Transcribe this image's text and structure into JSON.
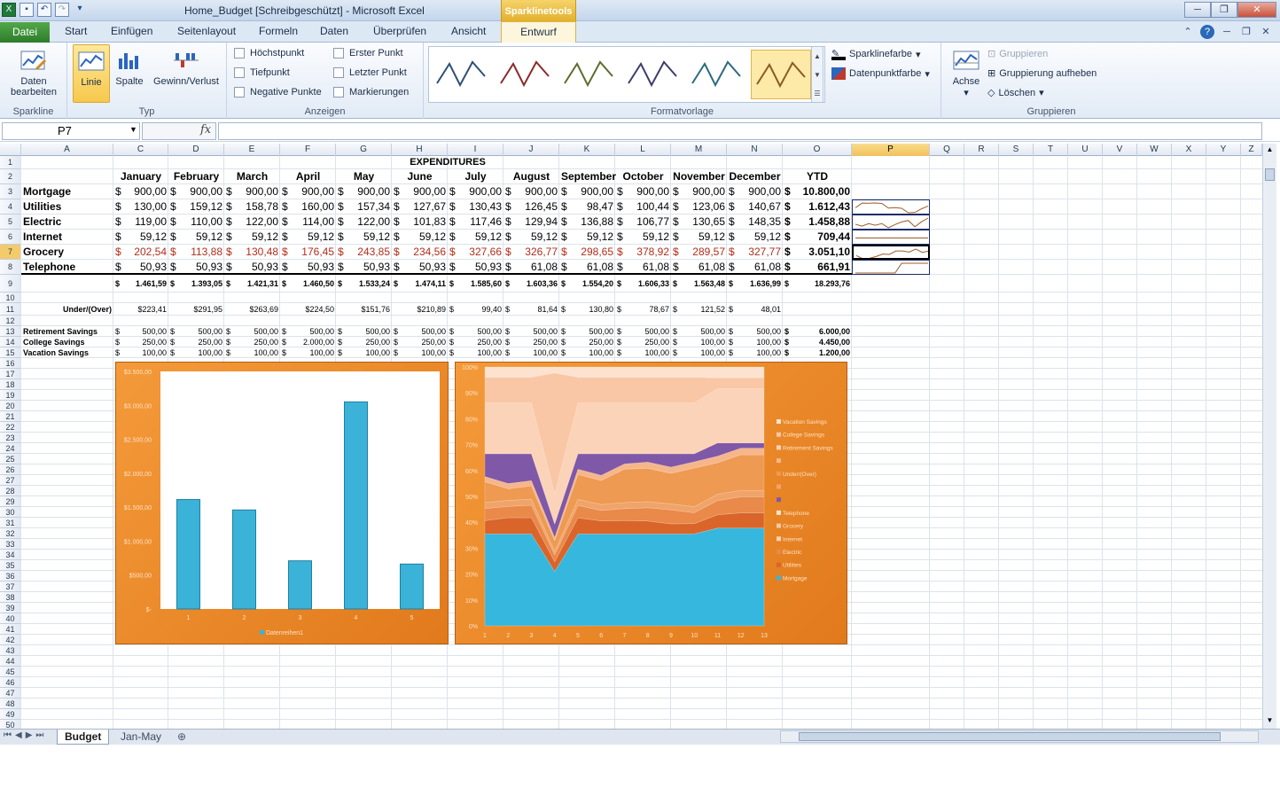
{
  "window": {
    "title": "Home_Budget  [Schreibgeschützt]  -  Microsoft Excel",
    "context_tab_group": "Sparklinetools",
    "controls": [
      "─",
      "❐",
      "✕"
    ]
  },
  "qat": {
    "icons": [
      "excel-icon",
      "save-icon",
      "undo-icon",
      "redo-icon",
      "customize-icon"
    ]
  },
  "tabs": {
    "file": "Datei",
    "items": [
      "Start",
      "Einfügen",
      "Seitenlayout",
      "Formeln",
      "Daten",
      "Überprüfen",
      "Ansicht"
    ],
    "context": "Entwurf"
  },
  "ribbon": {
    "sparkline_group": {
      "label": "Sparkline",
      "edit_data": "Daten\nbearbeiten"
    },
    "typ_group": {
      "label": "Typ",
      "line": "Linie",
      "column": "Spalte",
      "winloss": "Gewinn/Verlust"
    },
    "anzeigen_group": {
      "label": "Anzeigen",
      "high": "Höchstpunkt",
      "low": "Tiefpunkt",
      "negative": "Negative Punkte",
      "first": "Erster Punkt",
      "last": "Letzter Punkt",
      "markers": "Markierungen"
    },
    "style_group": {
      "label": "Formatvorlage",
      "sparkline_color": "Sparklinefarbe",
      "marker_color": "Datenpunktfarbe",
      "swatches": [
        "#2e4f77",
        "#8b2a2a",
        "#5c6d2c",
        "#3c3c6c",
        "#2c6a7c",
        "#8a5a24"
      ]
    },
    "axis_group": {
      "axis": "Achse"
    },
    "group_group": {
      "label": "Gruppieren",
      "group": "Gruppieren",
      "ungroup": "Gruppierung aufheben",
      "clear": "Löschen"
    }
  },
  "formula": {
    "namebox": "P7",
    "fx": "fx",
    "value": ""
  },
  "sheet": {
    "col_letters": [
      "A",
      "C",
      "D",
      "E",
      "F",
      "G",
      "H",
      "I",
      "J",
      "K",
      "L",
      "M",
      "N",
      "O",
      "P",
      "Q",
      "R",
      "S",
      "T",
      "U",
      "V",
      "W",
      "X",
      "Y",
      "Z"
    ],
    "title": "EXPENDITURES",
    "months": [
      "January",
      "February",
      "March",
      "April",
      "May",
      "June",
      "July",
      "August",
      "September",
      "October",
      "November",
      "December",
      "YTD"
    ],
    "rows": [
      {
        "label": "Mortgage",
        "values": [
          "900,00",
          "900,00",
          "900,00",
          "900,00",
          "900,00",
          "900,00",
          "900,00",
          "900,00",
          "900,00",
          "900,00",
          "900,00",
          "900,00"
        ],
        "ytd": "10.800,00"
      },
      {
        "label": "Utilities",
        "values": [
          "130,00",
          "159,12",
          "158,78",
          "160,00",
          "157,34",
          "127,67",
          "130,43",
          "126,45",
          "98,47",
          "100,44",
          "123,06",
          "140,67"
        ],
        "ytd": "1.612,43"
      },
      {
        "label": "Electric",
        "values": [
          "119,00",
          "110,00",
          "122,00",
          "114,00",
          "122,00",
          "101,83",
          "117,46",
          "129,94",
          "136,88",
          "106,77",
          "130,65",
          "148,35"
        ],
        "ytd": "1.458,88"
      },
      {
        "label": "Internet",
        "values": [
          "59,12",
          "59,12",
          "59,12",
          "59,12",
          "59,12",
          "59,12",
          "59,12",
          "59,12",
          "59,12",
          "59,12",
          "59,12",
          "59,12"
        ],
        "ytd": "709,44"
      },
      {
        "label": "Grocery",
        "values": [
          "202,54",
          "113,88",
          "130,48",
          "176,45",
          "243,85",
          "234,56",
          "327,66",
          "326,77",
          "298,65",
          "378,92",
          "289,57",
          "327,77"
        ],
        "ytd": "3.051,10"
      },
      {
        "label": "Telephone",
        "values": [
          "50,93",
          "50,93",
          "50,93",
          "50,93",
          "50,93",
          "50,93",
          "50,93",
          "61,08",
          "61,08",
          "61,08",
          "61,08",
          "61,08"
        ],
        "ytd": "661,91"
      }
    ],
    "totals": [
      "1.461,59",
      "1.393,05",
      "1.421,31",
      "1.460,50",
      "1.533,24",
      "1.474,11",
      "1.585,60",
      "1.603,36",
      "1.554,20",
      "1.606,33",
      "1.563,48",
      "1.636,99"
    ],
    "totals_ytd": "18.293,76",
    "under_label": "Under/(Over)",
    "under": [
      "$223,41",
      "$291,95",
      "$263,69",
      "$224,50",
      "$151,76",
      "$210,89",
      "99,40",
      "81,64",
      "130,80",
      "78,67",
      "121,52",
      "48,01"
    ],
    "savings": [
      {
        "label": "Retirement Savings",
        "values": [
          "500,00",
          "500,00",
          "500,00",
          "500,00",
          "500,00",
          "500,00",
          "500,00",
          "500,00",
          "500,00",
          "500,00",
          "500,00",
          "500,00"
        ],
        "ytd": "6.000,00"
      },
      {
        "label": "College Savings",
        "values": [
          "250,00",
          "250,00",
          "250,00",
          "2.000,00",
          "250,00",
          "250,00",
          "250,00",
          "250,00",
          "250,00",
          "250,00",
          "100,00",
          "100,00"
        ],
        "ytd": "4.450,00"
      },
      {
        "label": "Vacation Savings",
        "values": [
          "100,00",
          "100,00",
          "100,00",
          "100,00",
          "100,00",
          "100,00",
          "100,00",
          "100,00",
          "100,00",
          "100,00",
          "100,00",
          "100,00"
        ],
        "ytd": "1.200,00"
      }
    ],
    "currency": "$"
  },
  "chart_data": [
    {
      "type": "bar",
      "categories": [
        "1",
        "2",
        "3",
        "4",
        "5"
      ],
      "series": [
        {
          "name": "Datenreihen1",
          "values": [
            1612.43,
            1458.88,
            709.44,
            3051.1,
            661.91
          ]
        }
      ],
      "ylim": [
        0,
        3500
      ],
      "yticks": [
        "$-",
        "$500,00",
        "$1.000,00",
        "$1.500,00",
        "$2.000,00",
        "$2.500,00",
        "$3.000,00",
        "$3.500,00"
      ],
      "legend": "bottom"
    },
    {
      "type": "area",
      "stacked_percent": true,
      "categories": [
        "1",
        "2",
        "3",
        "4",
        "5",
        "6",
        "7",
        "8",
        "9",
        "10",
        "11",
        "12",
        "13"
      ],
      "yticks": [
        "0%",
        "10%",
        "20%",
        "30%",
        "40%",
        "50%",
        "60%",
        "70%",
        "80%",
        "90%",
        "100%"
      ],
      "legend": "right",
      "legend_entries": [
        "Vacation Savings",
        "College Savings",
        "Retirement Savings",
        "",
        "Under/(Over)",
        "",
        "",
        "Telephone",
        "Grocery",
        "Internet",
        "Electric",
        "Utilities",
        "Mortgage"
      ]
    }
  ],
  "sheettabs": {
    "tabs": [
      "Budget",
      "Jan-May"
    ],
    "active": "Budget"
  }
}
